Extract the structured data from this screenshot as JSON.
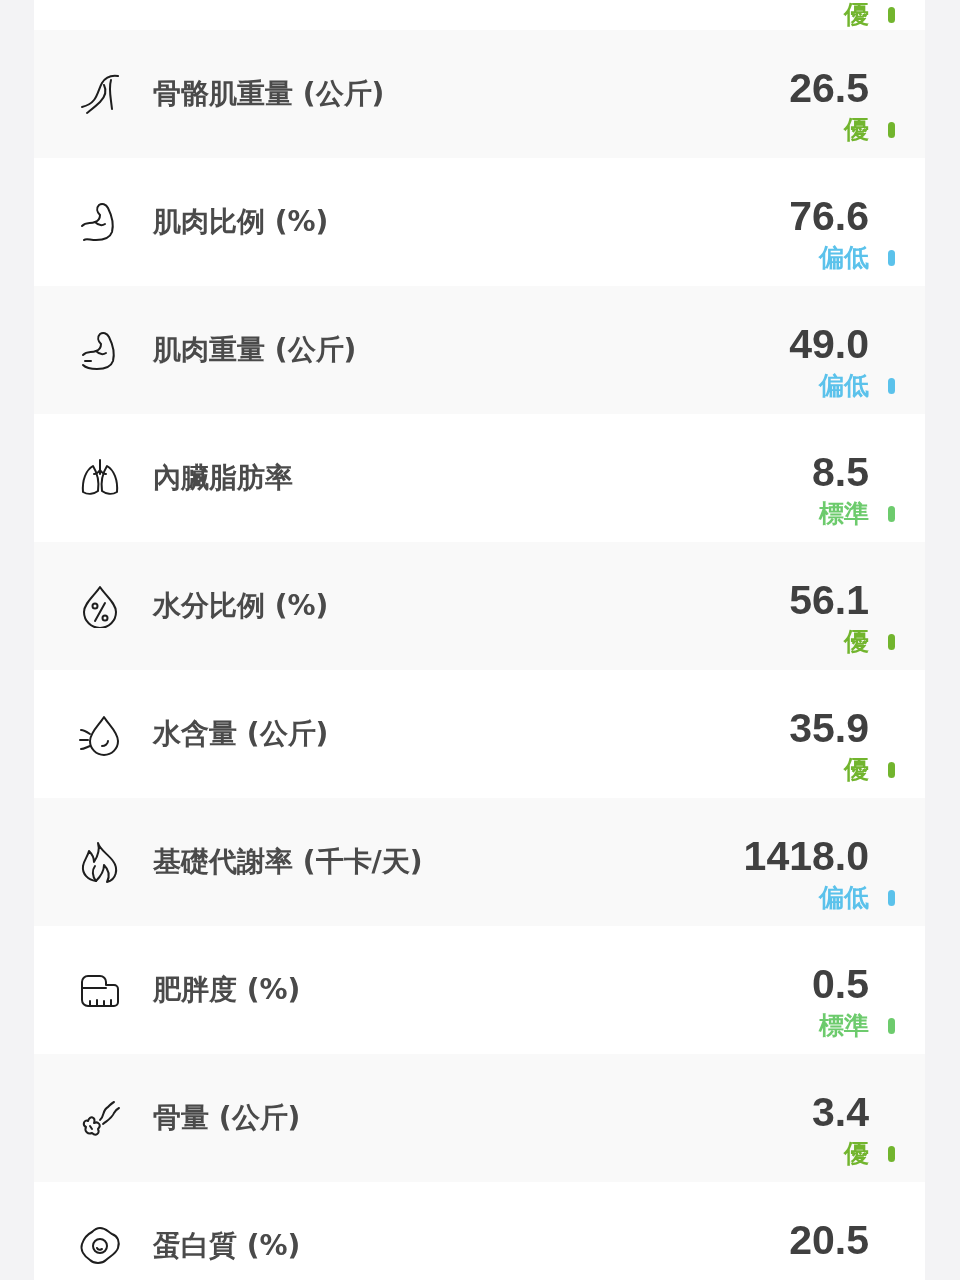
{
  "metrics": [
    {
      "status": "優",
      "color": "#72b52e"
    },
    {
      "label": "骨骼肌重量 (公斤)",
      "value": "26.5",
      "status": "優",
      "color": "#72b52e"
    },
    {
      "label": "肌肉比例 (%)",
      "value": "76.6",
      "status": "偏低",
      "color": "#5bc2eb"
    },
    {
      "label": "肌肉重量 (公斤)",
      "value": "49.0",
      "status": "偏低",
      "color": "#5bc2eb"
    },
    {
      "label": "內臟脂肪率",
      "value": "8.5",
      "status": "標準",
      "color": "#6dcb6d"
    },
    {
      "label": "水分比例 (%)",
      "value": "56.1",
      "status": "優",
      "color": "#72b52e"
    },
    {
      "label": "水含量 (公斤)",
      "value": "35.9",
      "status": "優",
      "color": "#72b52e"
    },
    {
      "label": "基礎代謝率 (千卡/天)",
      "value": "1418.0",
      "status": "偏低",
      "color": "#5bc2eb"
    },
    {
      "label": "肥胖度 (%)",
      "value": "0.5",
      "status": "標準",
      "color": "#6dcb6d"
    },
    {
      "label": "骨量 (公斤)",
      "value": "3.4",
      "status": "優",
      "color": "#72b52e"
    },
    {
      "label": "蛋白質 (%)",
      "value": "20.5"
    }
  ]
}
